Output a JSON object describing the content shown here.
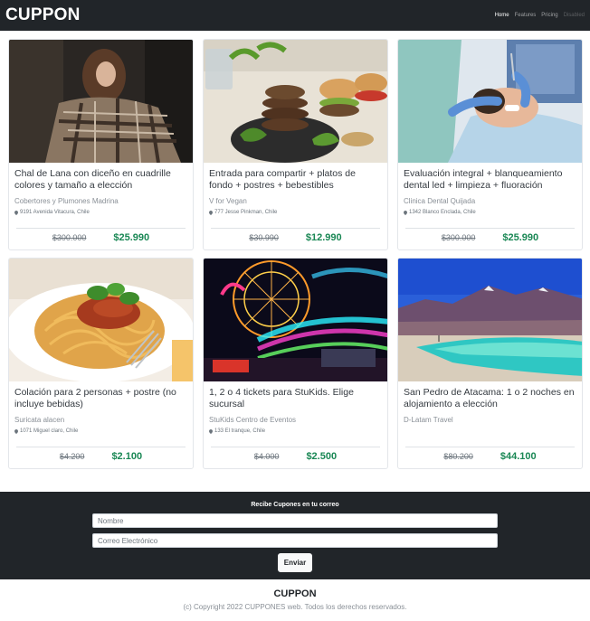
{
  "nav": {
    "brand": "CUPPON",
    "links": [
      "Home",
      "Features",
      "Pricing",
      "Disabled"
    ]
  },
  "cards": [
    {
      "title": "Chal de Lana con diceño en cuadrille colores y tamaño a elección",
      "vendor": "Cobertores y Plumones Madrina",
      "address": "9191 Avenida Vitacura, Chile",
      "old_price": "$300.000",
      "new_price": "$25.990",
      "image": "woman-in-blanket-photo"
    },
    {
      "title": "Entrada para compartir + platos de fondo + postres + bebestibles",
      "vendor": "V for Vegan",
      "address": "777 Jesse Pinkman, Chile",
      "old_price": "$30.990",
      "new_price": "$12.990",
      "image": "vegan-burgers-photo"
    },
    {
      "title": "Evaluación integral + blanqueamiento dental led + limpieza + fluoración",
      "vendor": "Clinica Dental Quijada",
      "address": "1342 Blanco Enclada, Chile",
      "old_price": "$300.000",
      "new_price": "$25.990",
      "image": "dentist-photo"
    },
    {
      "title": "Colación para 2 personas + postre (no incluye bebidas)",
      "vendor": "Suricata alacen",
      "address": "1071 Miguel claro, Chile",
      "old_price": "$4.200",
      "new_price": "$2.100",
      "image": "spaghetti-photo"
    },
    {
      "title": "1, 2 o 4 tickets para StuKids. Elige sucursal",
      "vendor": "StuKids Centro de Eventos",
      "address": "133 El tranque, Chile",
      "old_price": "$4.000",
      "new_price": "$2.500",
      "image": "fairground-rides-photo"
    },
    {
      "title": "San Pedro de Atacama: 1 o 2 noches en alojamiento a elección",
      "vendor": "D-Latam Travel",
      "address": "",
      "old_price": "$80.200",
      "new_price": "$44.100",
      "image": "atacama-lagoon-photo"
    }
  ],
  "newsletter": {
    "title": "Recibe Cupones en tu correo",
    "name_placeholder": "Nombre",
    "email_placeholder": "Correo Electrónico",
    "submit_label": "Enviar"
  },
  "footer": {
    "brand": "CUPPON",
    "copyright": "(c) Copyright 2022 CUPPONES web. Todos los derechos reservados."
  },
  "colors": {
    "navbar": "#212529",
    "price_green": "#198754"
  }
}
